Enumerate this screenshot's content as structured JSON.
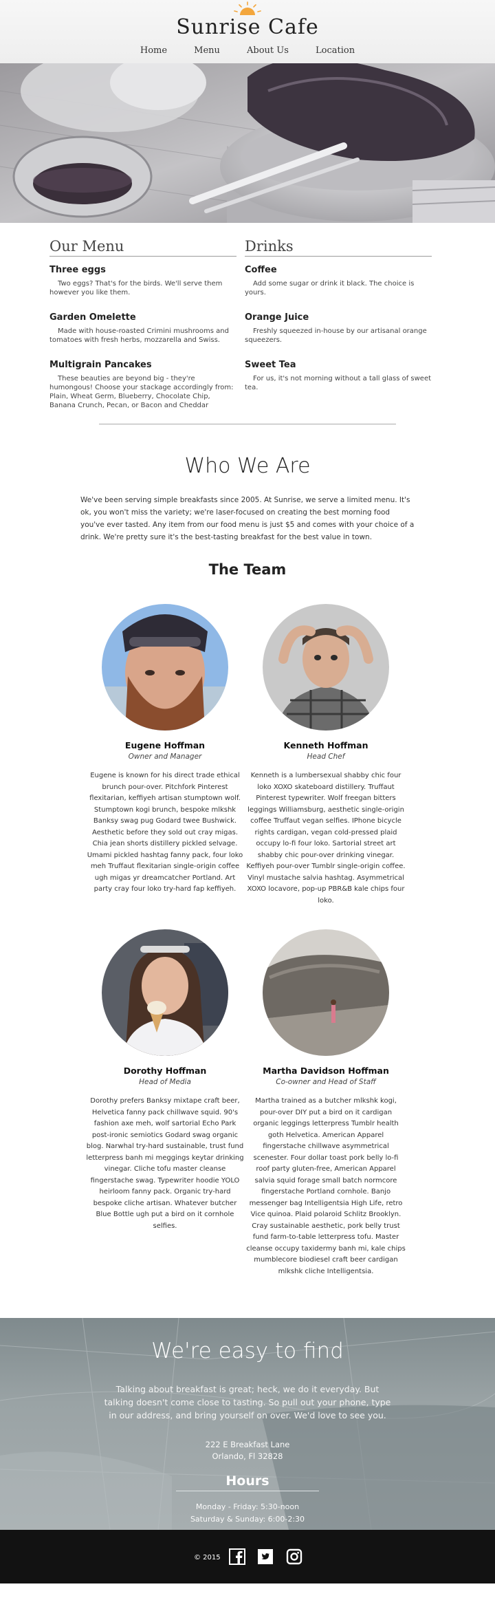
{
  "header": {
    "brand": "Sunrise Cafe",
    "nav": [
      "Home",
      "Menu",
      "About Us",
      "Location"
    ]
  },
  "menu": {
    "food_heading": "Our Menu",
    "drinks_heading": "Drinks",
    "food": [
      {
        "name": "Three eggs",
        "desc": "Two eggs? That's for the birds. We'll serve them however you like them."
      },
      {
        "name": "Garden Omelette",
        "desc": "Made with house-roasted Crimini mushrooms and tomatoes with fresh herbs, mozzarella and Swiss."
      },
      {
        "name": "Multigrain Pancakes",
        "desc": "These beauties are beyond big - they're humongous! Choose your stackage accordingly from: Plain, Wheat Germ, Blueberry, Chocolate Chip, Banana Crunch, Pecan, or Bacon and Cheddar"
      }
    ],
    "drinks": [
      {
        "name": "Coffee",
        "desc": "Add some sugar or drink it black. The choice is yours."
      },
      {
        "name": "Orange Juice",
        "desc": "Freshly squeezed in-house by our artisanal orange squeezers."
      },
      {
        "name": "Sweet Tea",
        "desc": "For us, it's not morning without a tall glass of sweet tea."
      }
    ]
  },
  "about": {
    "title": "Who We Are",
    "text": "We've been serving simple breakfasts since 2005. At Sunrise, we serve a limited menu. It's ok, you won't miss the variety; we're laser-focused on creating the best morning food you've ever tasted. Any item from our food menu is just $5 and comes with your choice of a drink. We're pretty sure it's the best-tasting breakfast for the best value in town.",
    "team_title": "The Team",
    "team": [
      {
        "name": "Eugene Hoffman",
        "role": "Owner and Manager",
        "bio": "Eugene is known for his direct trade ethical brunch pour-over. Pitchfork Pinterest flexitarian, keffiyeh artisan stumptown wolf. Stumptown kogi brunch, bespoke mlkshk Banksy swag pug Godard twee Bushwick. Aesthetic before they sold out cray migas. Chia jean shorts distillery pickled selvage. Umami pickled hashtag fanny pack, four loko meh Truffaut flexitarian single-origin coffee ugh migas yr dreamcatcher Portland. Art party cray four loko try-hard fap keffiyeh."
      },
      {
        "name": "Kenneth Hoffman",
        "role": "Head Chef",
        "bio": "Kenneth is a lumbersexual shabby chic four loko XOXO skateboard distillery. Truffaut Pinterest typewriter. Wolf freegan bitters leggings Williamsburg, aesthetic single-origin coffee Truffaut vegan selfies. IPhone bicycle rights cardigan, vegan cold-pressed plaid occupy lo-fi four loko. Sartorial street art shabby chic pour-over drinking vinegar. Keffiyeh pour-over Tumblr single-origin coffee. Vinyl mustache salvia hashtag. Asymmetrical XOXO locavore, pop-up PBR&B kale chips four loko."
      },
      {
        "name": "Dorothy Hoffman",
        "role": "Head of Media",
        "bio": "Dorothy prefers Banksy mixtape craft beer, Helvetica fanny pack chillwave squid. 90's fashion axe meh, wolf sartorial Echo Park post-ironic semiotics Godard swag organic blog. Narwhal try-hard sustainable, trust fund letterpress banh mi meggings keytar drinking vinegar. Cliche tofu master cleanse fingerstache swag. Typewriter hoodie YOLO heirloom fanny pack. Organic try-hard bespoke cliche artisan. Whatever butcher Blue Bottle ugh put a bird on it cornhole selfies."
      },
      {
        "name": "Martha Davidson Hoffman",
        "role": "Co-owner and Head of Staff",
        "bio": "Martha trained as a butcher mlkshk kogi, pour-over DIY put a bird on it cardigan organic leggings letterpress Tumblr health goth Helvetica. American Apparel fingerstache chillwave asymmetrical scenester. Four dollar toast pork belly lo-fi roof party gluten-free, American Apparel salvia squid forage small batch normcore fingerstache Portland cornhole. Banjo messenger bag Intelligentsia High Life, retro Vice quinoa. Plaid polaroid Schlitz Brooklyn. Cray sustainable aesthetic, pork belly trust fund farm-to-table letterpress tofu. Master cleanse occupy taxidermy banh mi, kale chips mumblecore biodiesel craft beer cardigan mlkshk cliche Intelligentsia."
      }
    ]
  },
  "find": {
    "title": "We're easy to find",
    "text": "Talking about breakfast is great; heck, we do it everyday. But talking doesn't come close to tasting. So pull out your phone, type in our address, and bring yourself on over. We'd love to see you.",
    "address_line1": "222 E Breakfast Lane",
    "address_line2": "Orlando, Fl 32828",
    "hours_title": "Hours",
    "hours_line1": "Monday - Friday: 5:30-noon",
    "hours_line2": "Saturday & Sunday: 6:00-2:30"
  },
  "footer": {
    "copyright": "© 2015",
    "social": [
      "facebook-icon",
      "twitter-icon",
      "instagram-icon"
    ]
  },
  "colors": {
    "sun": "#f3a63c",
    "footer_bg": "#121212",
    "find_bg": "#9aa3a5"
  }
}
